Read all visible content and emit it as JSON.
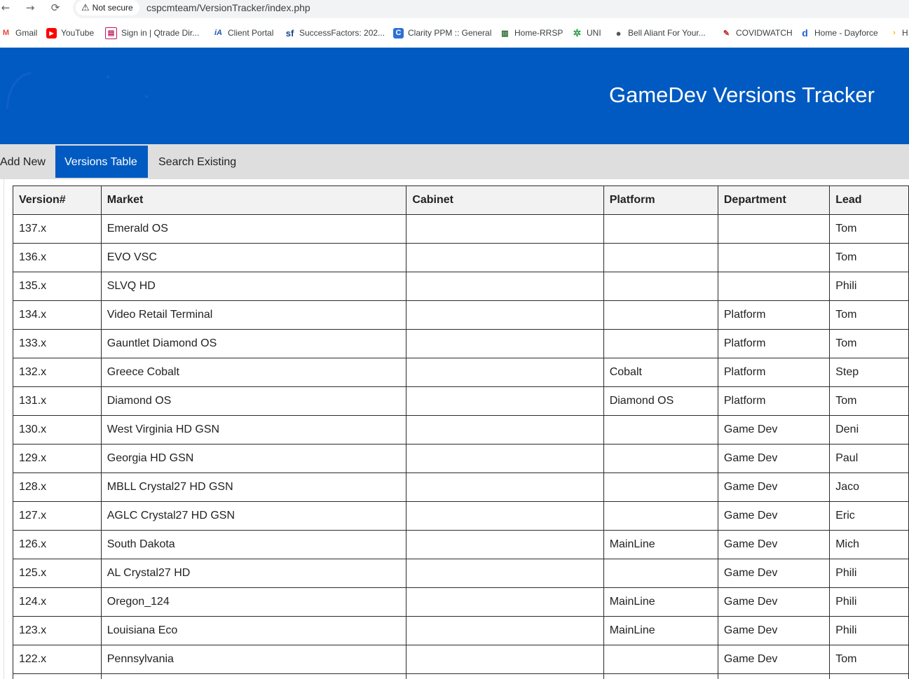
{
  "browser": {
    "back_icon": "←",
    "forward_icon": "→",
    "reload_icon": "⟳",
    "security_icon": "⚠",
    "security_label": "Not secure",
    "url": "cspcmteam/VersionTracker/index.php",
    "bookmarks": [
      {
        "label": "Gmail",
        "icon": "M",
        "color": "#ea4335"
      },
      {
        "label": "YouTube",
        "icon": "▶",
        "color": "#ff0000"
      },
      {
        "label": "Sign in | Qtrade Dir...",
        "icon": "▤",
        "color": "#c2185b"
      },
      {
        "label": "Client Portal",
        "icon": "iA",
        "color": "#1a56b8"
      },
      {
        "label": "SuccessFactors: 202...",
        "icon": "sf",
        "color": "#1a3f8f"
      },
      {
        "label": "Clarity PPM :: General",
        "icon": "C",
        "color": "#2f6fd6"
      },
      {
        "label": "Home-RRSP",
        "icon": "▥",
        "color": "#1b5e20"
      },
      {
        "label": "UNI",
        "icon": "✲",
        "color": "#2e9d4a"
      },
      {
        "label": "Bell Aliant For Your...",
        "icon": "●",
        "color": "#555555"
      },
      {
        "label": "COVIDWATCH",
        "icon": "✎",
        "color": "#c62828"
      },
      {
        "label": "Home - Dayforce",
        "icon": "d",
        "color": "#1e63d6"
      },
      {
        "label": "H",
        "icon": "›",
        "color": "#f4b400"
      }
    ]
  },
  "header": {
    "title": "GameDev Versions Tracker"
  },
  "tabs": [
    {
      "label": "Add New",
      "active": false
    },
    {
      "label": "Versions Table",
      "active": true
    },
    {
      "label": "Search Existing",
      "active": false
    }
  ],
  "table": {
    "columns": [
      "Version#",
      "Market",
      "Cabinet",
      "Platform",
      "Department",
      "Lead"
    ],
    "rows": [
      [
        "137.x",
        "Emerald OS",
        "",
        "",
        "",
        "Tom"
      ],
      [
        "136.x",
        "EVO VSC",
        "",
        "",
        "",
        "Tom"
      ],
      [
        "135.x",
        "SLVQ HD",
        "",
        "",
        "",
        "Phili"
      ],
      [
        "134.x",
        "Video Retail Terminal",
        "",
        "",
        "Platform",
        "Tom"
      ],
      [
        "133.x",
        "Gauntlet Diamond OS",
        "",
        "",
        "Platform",
        "Tom"
      ],
      [
        "132.x",
        "Greece Cobalt",
        "",
        "Cobalt",
        "Platform",
        "Step"
      ],
      [
        "131.x",
        "Diamond OS",
        "",
        "Diamond OS",
        "Platform",
        "Tom"
      ],
      [
        "130.x",
        "West Virginia HD GSN",
        "",
        "",
        "Game Dev",
        "Deni"
      ],
      [
        "129.x",
        "Georgia HD GSN",
        "",
        "",
        "Game Dev",
        "Paul"
      ],
      [
        "128.x",
        "MBLL Crystal27 HD GSN",
        "",
        "",
        "Game Dev",
        "Jaco"
      ],
      [
        "127.x",
        "AGLC Crystal27 HD GSN",
        "",
        "",
        "Game Dev",
        "Eric"
      ],
      [
        "126.x",
        "South Dakota",
        "",
        "MainLine",
        "Game Dev",
        "Mich"
      ],
      [
        "125.x",
        "AL Crystal27 HD",
        "",
        "",
        "Game Dev",
        "Phili"
      ],
      [
        "124.x",
        "Oregon_124",
        "",
        "MainLine",
        "Game Dev",
        "Phili"
      ],
      [
        "123.x",
        "Louisiana Eco",
        "",
        "MainLine",
        "Game Dev",
        "Phili"
      ],
      [
        "122.x",
        "Pennsylvania",
        "",
        "",
        "Game Dev",
        "Tom"
      ],
      [
        "",
        "",
        "",
        "",
        "",
        ""
      ]
    ]
  },
  "colors": {
    "brand_blue": "#005ac1",
    "tabbar_bg": "#dedede",
    "header_cell_bg": "#f2f2f2"
  }
}
